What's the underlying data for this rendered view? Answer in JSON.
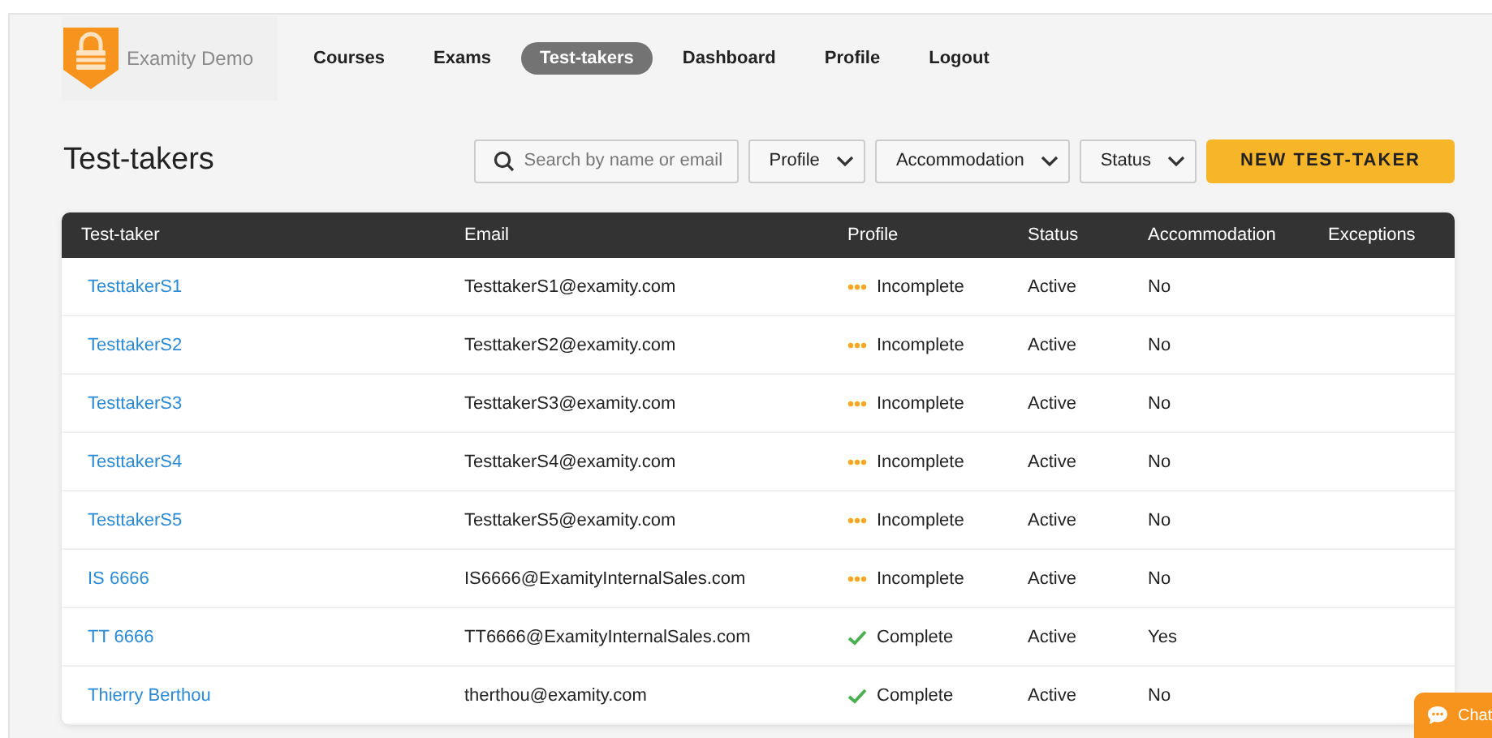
{
  "brand": {
    "name": "Examity Demo"
  },
  "nav": [
    {
      "label": "Courses",
      "selected": false
    },
    {
      "label": "Exams",
      "selected": false
    },
    {
      "label": "Test-takers",
      "selected": true
    },
    {
      "label": "Dashboard",
      "selected": false
    },
    {
      "label": "Profile",
      "selected": false
    },
    {
      "label": "Logout",
      "selected": false
    }
  ],
  "page_title": "Test-takers",
  "search": {
    "placeholder": "Search by name or email"
  },
  "filters": [
    "Profile",
    "Accommodation",
    "Status"
  ],
  "new_button": "NEW TEST-TAKER",
  "table": {
    "columns": [
      "Test-taker",
      "Email",
      "Profile",
      "Status",
      "Accommodation",
      "Exceptions"
    ],
    "rows": [
      {
        "name": "TesttakerS1",
        "email": "TesttakerS1@examity.com",
        "profile": {
          "kind": "incomplete",
          "label": "Incomplete"
        },
        "status": "Active",
        "accommodation": "No"
      },
      {
        "name": "TesttakerS2",
        "email": "TesttakerS2@examity.com",
        "profile": {
          "kind": "incomplete",
          "label": "Incomplete"
        },
        "status": "Active",
        "accommodation": "No"
      },
      {
        "name": "TesttakerS3",
        "email": "TesttakerS3@examity.com",
        "profile": {
          "kind": "incomplete",
          "label": "Incomplete"
        },
        "status": "Active",
        "accommodation": "No"
      },
      {
        "name": "TesttakerS4",
        "email": "TesttakerS4@examity.com",
        "profile": {
          "kind": "incomplete",
          "label": "Incomplete"
        },
        "status": "Active",
        "accommodation": "No"
      },
      {
        "name": "TesttakerS5",
        "email": "TesttakerS5@examity.com",
        "profile": {
          "kind": "incomplete",
          "label": "Incomplete"
        },
        "status": "Active",
        "accommodation": "No"
      },
      {
        "name": "IS 6666",
        "email": "IS6666@ExamityInternalSales.com",
        "profile": {
          "kind": "incomplete",
          "label": "Incomplete"
        },
        "status": "Active",
        "accommodation": "No"
      },
      {
        "name": "TT 6666",
        "email": "TT6666@ExamityInternalSales.com",
        "profile": {
          "kind": "complete",
          "label": "Complete"
        },
        "status": "Active",
        "accommodation": "Yes"
      },
      {
        "name": "Thierry Berthou",
        "email": "therthou@examity.com",
        "profile": {
          "kind": "complete",
          "label": "Complete"
        },
        "status": "Active",
        "accommodation": "No"
      }
    ]
  },
  "chat_button": "Chat"
}
